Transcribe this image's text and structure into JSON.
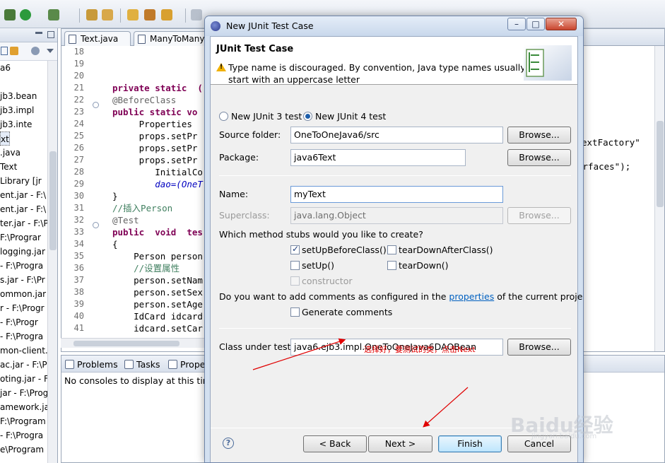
{
  "left_panel": {
    "items": [
      "a6",
      "",
      "jb3.bean",
      "jb3.impl",
      "jb3.inte",
      "xt",
      ".java",
      "Text",
      "Library [jr",
      "ent.jar - F:\\",
      "ent.jar - F:\\",
      "ter.jar - F:\\P",
      "F:\\Prograr",
      "logging.jar",
      "- F:\\Progra",
      "s.jar - F:\\Pr",
      "ommon.jar -",
      "r - F:\\Progr",
      "- F:\\Progr",
      "- F:\\Progra",
      "mon-client.",
      "ac.jar - F:\\P",
      "oting.jar - F",
      "jar - F:\\Prog",
      "amework.ja",
      "F:\\Program",
      "- F:\\Progra",
      "e\\Program"
    ]
  },
  "editor": {
    "tabs": [
      "Text.java",
      "ManyToMany"
    ],
    "line_numbers": [
      "18",
      "19",
      "20",
      "21",
      "22",
      "23",
      "24",
      "25",
      "26",
      "27",
      "28",
      "29",
      "30",
      "31",
      "32",
      "33",
      "34",
      "35",
      "36",
      "37",
      "38",
      "39",
      "40",
      "41"
    ],
    "code_lines": [
      "",
      "",
      "",
      "private static  (",
      "@BeforeClass",
      "public static vo",
      "     Properties",
      "     props.setPr",
      "     props.setPr",
      "     props.setPr",
      "        InitialCo",
      "        dao=(OneT",
      "}",
      "//插入Person",
      "@Test",
      "public  void  tes",
      "{",
      "    Person person",
      "    //设置属性",
      "    person.setNam",
      "    person.setSex",
      "    person.setAge",
      "    IdCard idcard",
      "    idcard.setCar"
    ],
    "right_fragment_1": "extFactory\"",
    "right_fragment_2": "erfaces\");"
  },
  "console": {
    "tabs": [
      "Problems",
      "Tasks",
      "Prope"
    ],
    "message": "No consoles to display at this time"
  },
  "dialog": {
    "title": "New JUnit Test Case",
    "header_title": "JUnit Test Case",
    "warning": "Type name is discouraged. By convention, Java type names usually start with an uppercase letter",
    "junit3_label": "New JUnit 3 test",
    "junit4_label": "New JUnit 4 test",
    "source_folder_label": "Source folder:",
    "source_folder_value": "OneToOneJava6/src",
    "package_label": "Package:",
    "package_value": "java6Text",
    "name_label": "Name:",
    "name_value": "myText",
    "superclass_label": "Superclass:",
    "superclass_value": "java.lang.Object",
    "browse_label": "Browse...",
    "stubs_question": "Which method stubs would you like to create?",
    "stub_setUpBeforeClass": "setUpBeforeClass()",
    "stub_tearDownAfterClass": "tearDownAfterClass()",
    "stub_setUp": "setUp()",
    "stub_tearDown": "tearDown()",
    "stub_constructor": "constructor",
    "comments_question_pre": "Do you want to add comments as configured in the",
    "comments_link": "properties",
    "comments_question_post": "of the current project?",
    "generate_comments": "Generate comments",
    "class_under_test_label": "Class under test:",
    "class_under_test_value": "java6.ejb3.impl.OneToOneJava6DAOBean",
    "back_label": "< Back",
    "next_label": "Next >",
    "finish_label": "Finish",
    "cancel_label": "Cancel"
  },
  "annotation": "选择好，要测试的类，点击Next",
  "watermark": {
    "text": "Baidu经验",
    "url": "jingyan.baidu.com"
  }
}
